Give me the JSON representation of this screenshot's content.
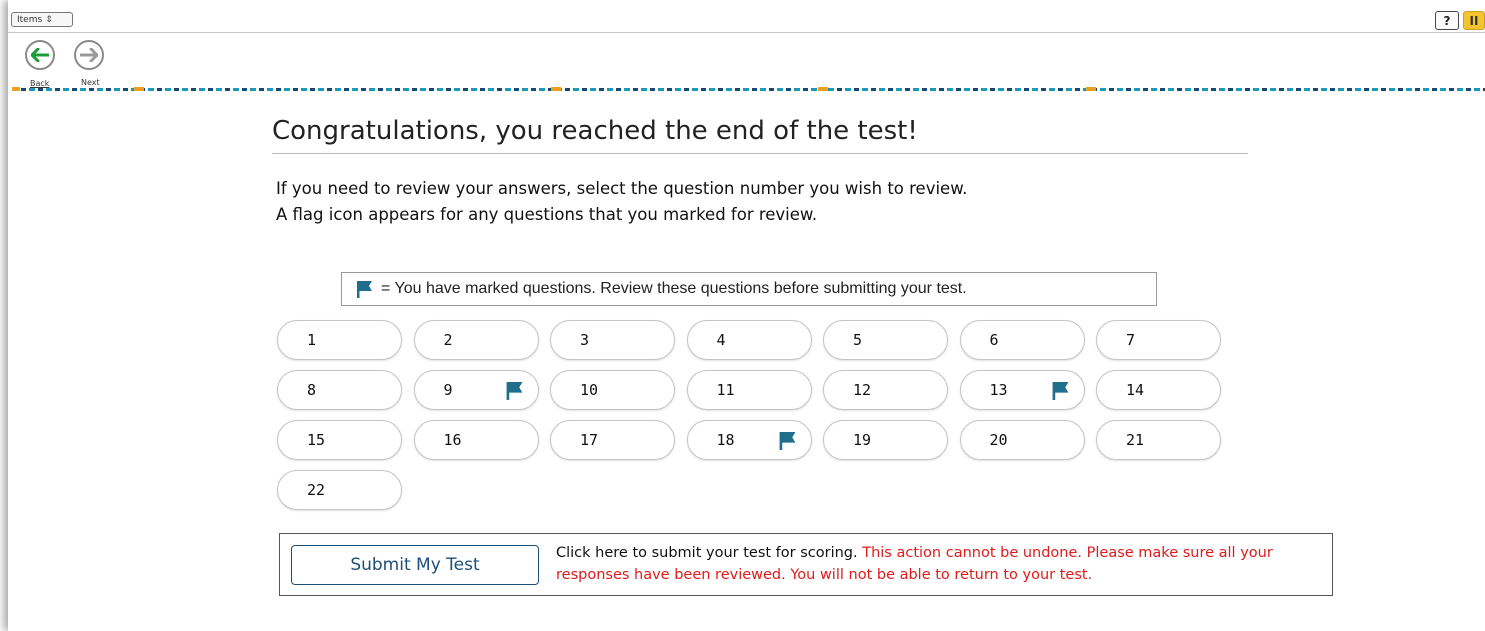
{
  "toolbar": {
    "items_label": "Items",
    "help_label": "?",
    "pause_label": "II"
  },
  "nav": {
    "back_label": "Back",
    "next_label": "Next"
  },
  "page": {
    "title": "Congratulations, you reached the end of the test!",
    "instruction_line1": "If you need to review your answers, select the question number you wish to review.",
    "instruction_line2": "A flag icon appears for any questions that you marked for review."
  },
  "legend": {
    "text": "= You have marked questions. Review these questions before submitting your test."
  },
  "questions": [
    {
      "number": "1",
      "flagged": false
    },
    {
      "number": "2",
      "flagged": false
    },
    {
      "number": "3",
      "flagged": false
    },
    {
      "number": "4",
      "flagged": false
    },
    {
      "number": "5",
      "flagged": false
    },
    {
      "number": "6",
      "flagged": false
    },
    {
      "number": "7",
      "flagged": false
    },
    {
      "number": "8",
      "flagged": false
    },
    {
      "number": "9",
      "flagged": true
    },
    {
      "number": "10",
      "flagged": false
    },
    {
      "number": "11",
      "flagged": false
    },
    {
      "number": "12",
      "flagged": false
    },
    {
      "number": "13",
      "flagged": true
    },
    {
      "number": "14",
      "flagged": false
    },
    {
      "number": "15",
      "flagged": false
    },
    {
      "number": "16",
      "flagged": false
    },
    {
      "number": "17",
      "flagged": false
    },
    {
      "number": "18",
      "flagged": true
    },
    {
      "number": "19",
      "flagged": false
    },
    {
      "number": "20",
      "flagged": false
    },
    {
      "number": "21",
      "flagged": false
    },
    {
      "number": "22",
      "flagged": false
    }
  ],
  "submit": {
    "button_label": "Submit My Test",
    "info_text": "Click here to submit your test for scoring. ",
    "warning_text": "This action cannot be undone. Please make sure all your responses have been reviewed. You will not be able to return to your test."
  },
  "colors": {
    "flag": "#1f6e8c",
    "back_arrow": "#1a9c3a",
    "next_arrow": "#9a9a9a",
    "warning": "#e01b1b",
    "submit_button": "#1d4e78",
    "pause_button": "#f4c430"
  },
  "icons": {
    "flag": "flag-icon",
    "back": "arrow-left-icon",
    "next": "arrow-right-icon",
    "items_dropdown": "chevron-updown-icon"
  }
}
